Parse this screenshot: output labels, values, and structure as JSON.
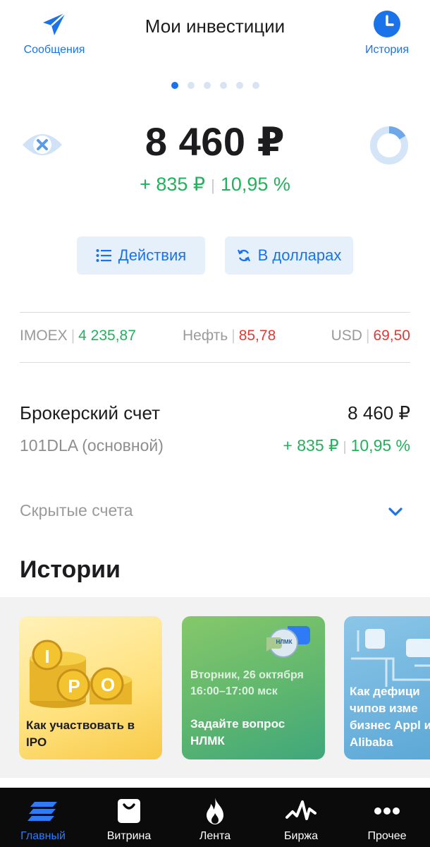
{
  "header": {
    "title": "Мои инвестиции",
    "messages_label": "Сообщения",
    "history_label": "История"
  },
  "pager": {
    "count": 6,
    "active_index": 0
  },
  "portfolio": {
    "balance": "8 460 ₽",
    "change_amount": "+ 835 ₽",
    "change_percent": "10,95 %"
  },
  "buttons": {
    "actions_label": "Действия",
    "usd_label": "В долларах"
  },
  "market": [
    {
      "name": "IMOEX",
      "value": "4 235,87",
      "trend": "up"
    },
    {
      "name": "Нефть",
      "value": "85,78",
      "trend": "down"
    },
    {
      "name": "USD",
      "value": "69,50",
      "trend": "down"
    }
  ],
  "account": {
    "name": "Брокерский счет",
    "id": "101DLA (основной)",
    "total": "8 460 ₽",
    "change_amount": "+ 835 ₽",
    "change_percent": "10,95 %"
  },
  "hidden_accounts_label": "Скрытые счета",
  "stories": {
    "title": "Истории",
    "items": [
      {
        "badge": "IPO",
        "text": "Как участвовать в IPO"
      },
      {
        "subtitle": "Вторник, 26 октября 16:00–17:00 мск",
        "badge": "НЛМК",
        "text": "Задайте вопрос НЛМК"
      },
      {
        "text": "Как дефици чипов изме бизнес Appl и Alibaba"
      }
    ]
  },
  "nav": [
    {
      "label": "Главный",
      "icon": "home-stack-icon",
      "active": true
    },
    {
      "label": "Витрина",
      "icon": "shopping-bag-icon",
      "active": false
    },
    {
      "label": "Лента",
      "icon": "flame-icon",
      "active": false
    },
    {
      "label": "Биржа",
      "icon": "pulse-chart-icon",
      "active": false
    },
    {
      "label": "Прочее",
      "icon": "more-dots-icon",
      "active": false
    }
  ],
  "colors": {
    "accent": "#1a73e8",
    "positive": "#1fb35b",
    "negative": "#e53935",
    "nav_bg": "#0b0b0b"
  }
}
